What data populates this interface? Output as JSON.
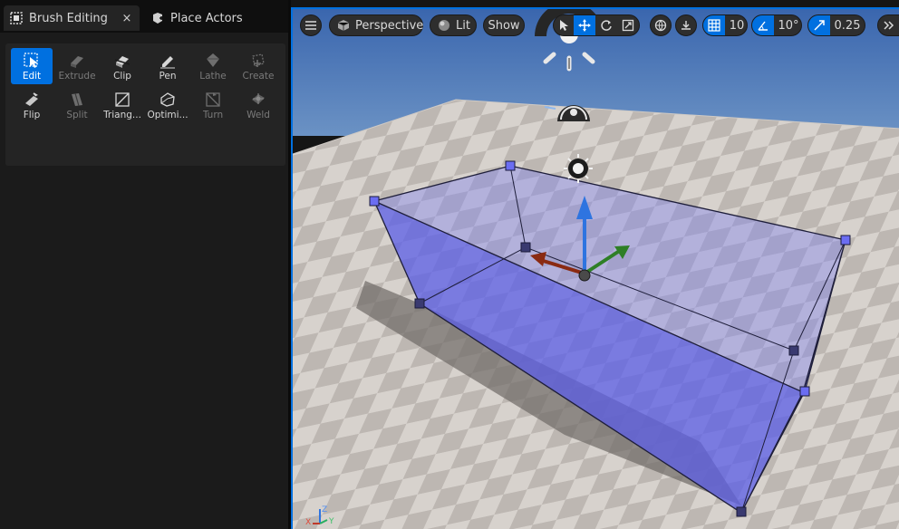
{
  "tabs": {
    "brush_editing": "Brush Editing",
    "close": "×",
    "place_actors": "Place Actors"
  },
  "tools": [
    {
      "label": "Edit",
      "icon": "edit-select-icon",
      "state": "active"
    },
    {
      "label": "Extrude",
      "icon": "extrude-icon",
      "state": "disabled"
    },
    {
      "label": "Clip",
      "icon": "clip-icon",
      "state": "enabled"
    },
    {
      "label": "Pen",
      "icon": "pen-icon",
      "state": "enabled"
    },
    {
      "label": "Lathe",
      "icon": "lathe-icon",
      "state": "disabled"
    },
    {
      "label": "Create",
      "icon": "create-icon",
      "state": "disabled"
    },
    {
      "label": "Flip",
      "icon": "flip-icon",
      "state": "enabled"
    },
    {
      "label": "Split",
      "icon": "split-icon",
      "state": "disabled"
    },
    {
      "label": "Triang...",
      "icon": "triangulate-icon",
      "state": "enabled"
    },
    {
      "label": "Optimi...",
      "icon": "optimize-icon",
      "state": "enabled"
    },
    {
      "label": "Turn",
      "icon": "turn-icon",
      "state": "disabled"
    },
    {
      "label": "Weld",
      "icon": "weld-icon",
      "state": "disabled"
    }
  ],
  "viewport": {
    "perspective": "Perspective",
    "lit": "Lit",
    "show": "Show",
    "grid_snap": "10",
    "rotation_snap": "10°",
    "scale_snap": "0.25",
    "axis_x": "X",
    "axis_y": "Y",
    "axis_z": "Z"
  },
  "colors": {
    "accent": "#0070e0",
    "brush_fill": "#6a6af0",
    "sky": "#3d6ab0"
  }
}
